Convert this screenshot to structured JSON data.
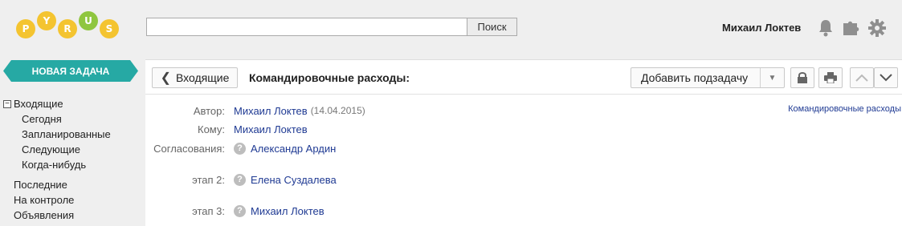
{
  "logo": {
    "letters": [
      "P",
      "Y",
      "R",
      "U",
      "S"
    ]
  },
  "search": {
    "value": "",
    "placeholder": "",
    "button_label": "Поиск"
  },
  "user": {
    "name": "Михаил Локтев"
  },
  "icons": {
    "bell": "bell-icon",
    "puzzle": "puzzle-icon",
    "settings": "gear-icon"
  },
  "sidebar": {
    "new_task_label": "НОВАЯ ЗАДАЧА",
    "inbox_label": "Входящие",
    "inbox_items": [
      "Сегодня",
      "Запланированные",
      "Следующие",
      "Когда-нибудь"
    ],
    "other_items": [
      "Последние",
      "На контроле",
      "Объявления"
    ]
  },
  "task": {
    "back_label": "Входящие",
    "title": "Командировочные расходы:",
    "add_subtask_label": "Добавить подзадачу",
    "form_link": "Командировочные расходы",
    "fields": {
      "author_label": "Автор:",
      "author_name": "Михаил Локтев",
      "author_date": "(14.04.2015)",
      "to_label": "Кому:",
      "to_name": "Михаил Локтев",
      "approvals_label": "Согласования:",
      "approvals": [
        {
          "stage": "",
          "name": "Александр Ардин"
        },
        {
          "stage": "этап 2:",
          "name": "Елена Суздалева"
        },
        {
          "stage": "этап 3:",
          "name": "Михаил Локтев"
        }
      ]
    }
  },
  "colors": {
    "accent": "#26a9a4",
    "link": "#1f3a93",
    "logo_yellow": "#f4c430",
    "logo_green": "#8fc63f"
  }
}
